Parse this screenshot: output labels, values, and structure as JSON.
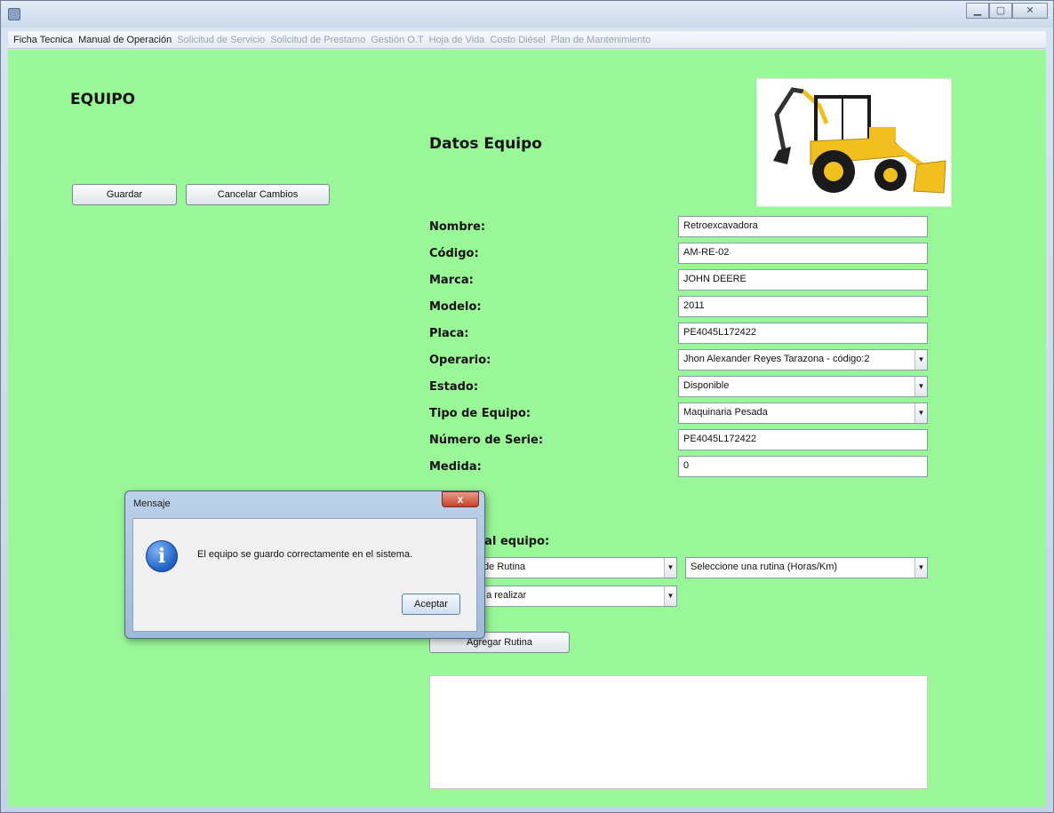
{
  "window": {
    "title": ""
  },
  "menu": {
    "items": [
      {
        "label": "Ficha Tecnica",
        "enabled": true
      },
      {
        "label": "Manual de Operación",
        "enabled": true
      },
      {
        "label": "Solicitud de Servicio",
        "enabled": false
      },
      {
        "label": "Solicitud de Prestamo",
        "enabled": false
      },
      {
        "label": "Gestión O.T",
        "enabled": false
      },
      {
        "label": "Hoja de Vida",
        "enabled": false
      },
      {
        "label": "Costo Diésel",
        "enabled": false
      },
      {
        "label": "Plan de Mantenimiento",
        "enabled": false
      }
    ]
  },
  "page": {
    "title": "EQUIPO",
    "section_title": "Datos Equipo",
    "buttons": {
      "save": "Guardar",
      "cancel": "Cancelar Cambios"
    },
    "image": {
      "subject": "backhoe-loader-photo",
      "colors": {
        "body": "#f2c01e",
        "tires": "#1a1a1a"
      }
    }
  },
  "form": {
    "nombre": {
      "label": "Nombre:",
      "value": "Retroexcavadora"
    },
    "codigo": {
      "label": "Código:",
      "value": "AM-RE-02"
    },
    "marca": {
      "label": "Marca:",
      "value": "JOHN DEERE"
    },
    "modelo": {
      "label": "Modelo:",
      "value": "2011"
    },
    "placa": {
      "label": "Placa:",
      "value": "PE4045L172422"
    },
    "operario": {
      "label": "Operario:",
      "value": "Jhon Alexander Reyes Tarazona - código:2"
    },
    "estado": {
      "label": "Estado:",
      "value": "Disponible"
    },
    "tipo": {
      "label": "Tipo de Equipo:",
      "value": "Maquinaria Pesada"
    },
    "serie": {
      "label": "Número de Serie:",
      "value": "PE4045L172422"
    },
    "medida": {
      "label": "Medida:",
      "value": "0"
    }
  },
  "rutina": {
    "section_label": "a rutina al equipo:",
    "metodo_select": "un metodo de Rutina",
    "rutina_select": "Seleccione una rutina (Horas/Km)",
    "actividad_select": "la actividad a realizar",
    "add_button": "Agregar Rutina"
  },
  "dialog": {
    "title": "Mensaje",
    "close_label": "x",
    "message": "El equipo se guardo correctamente en el sistema.",
    "ok_button": "Aceptar",
    "icon": "info-icon"
  },
  "colors": {
    "panel_background": "#99f797",
    "titlebar": "#cbd9eb",
    "dialog_frame": "#a9c2e1"
  }
}
